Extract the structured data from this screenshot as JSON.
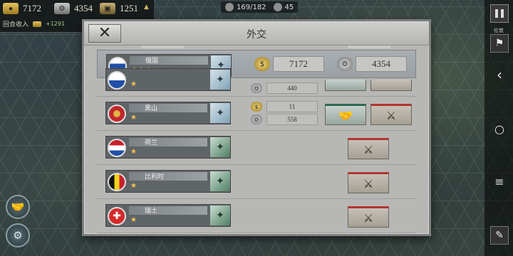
{
  "hud": {
    "gold": "7172",
    "industry": "4354",
    "supplies": "1251",
    "income_label": "回合收入",
    "income_gold": "+1291",
    "units_count": "169/182",
    "generals_count": "45",
    "expand_icon": "caret-up-icon"
  },
  "right_rail": {
    "pause_icon": "pause-icon",
    "flag_label": "伦敦",
    "menu_label": "",
    "back_icon": "‹",
    "home_icon": "○",
    "recent_icon": "≡"
  },
  "modal": {
    "title": "外交",
    "close_icon": "✕",
    "self": {
      "name": "俄国",
      "stars": "★★★",
      "gold": "7172",
      "industry": "4354"
    },
    "partial_row": {
      "stars": "★",
      "industry_value": "440"
    },
    "rows": [
      {
        "name": "黑山",
        "stars": "★",
        "gold_value": "11",
        "industry_value": "558",
        "has_peace": true
      },
      {
        "name": "荷兰",
        "stars": "★",
        "has_peace": false
      },
      {
        "name": "比利时",
        "stars": "★",
        "has_peace": false
      },
      {
        "name": "瑞士",
        "stars": "★",
        "has_peace": false
      }
    ]
  },
  "colors": {
    "war_accent": "#b5342f",
    "peace_accent": "#2e6b55",
    "star": "#f2c34a",
    "panel": "#b7b8b5"
  }
}
